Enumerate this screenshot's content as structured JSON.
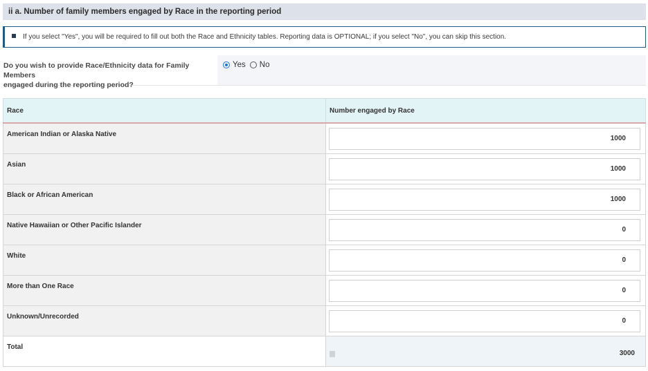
{
  "section": {
    "title": "ii a. Number of family members engaged by Race in the reporting period"
  },
  "info": {
    "text": "If you select \"Yes\", you will be required to fill out both the Race and Ethnicity tables. Reporting data is OPTIONAL; if you select \"No\", you can skip this section."
  },
  "question": {
    "line1": "Do you wish to provide Race/Ethnicity data for Family Members",
    "line2": "engaged during the reporting period?",
    "options": [
      {
        "label": "Yes",
        "checked": true
      },
      {
        "label": "No",
        "checked": false
      }
    ]
  },
  "table": {
    "headers": [
      "Race",
      "Number engaged by Race"
    ],
    "rows": [
      {
        "race": "American Indian or Alaska Native",
        "value": "1000"
      },
      {
        "race": "Asian",
        "value": "1000"
      },
      {
        "race": "Black or African American",
        "value": "1000"
      },
      {
        "race": "Native Hawaiian or Other Pacific Islander",
        "value": "0"
      },
      {
        "race": "White",
        "value": "0"
      },
      {
        "race": "More than One Race",
        "value": "0"
      },
      {
        "race": "Unknown/Unrecorded",
        "value": "0"
      }
    ],
    "total_label": "Total",
    "total_value": "3000"
  },
  "colors": {
    "header_bg": "#dde1e9",
    "info_border": "#1d5a87",
    "radio_accent": "#1a73e8",
    "table_header_bg": "#e3f4f7",
    "row_label_bg": "#f1f1f1"
  },
  "icons": {
    "info": "info-square-icon",
    "calc": "calculator-icon"
  }
}
